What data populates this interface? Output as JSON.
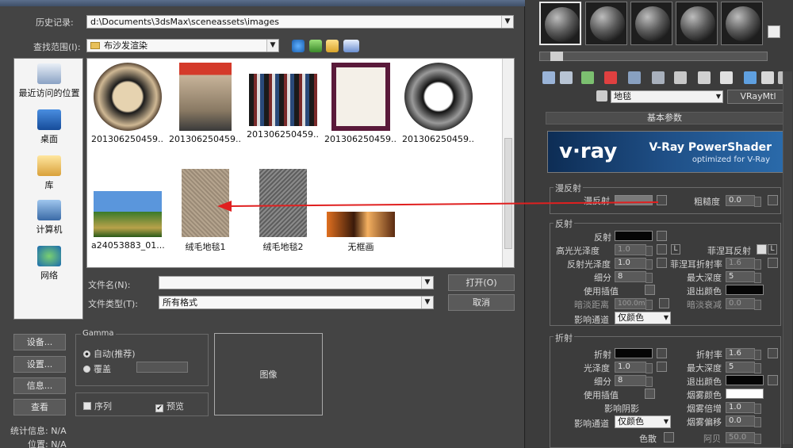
{
  "dialog": {
    "history_label": "历史记录:",
    "history_value": "d:\\Documents\\3dsMax\\sceneassets\\images",
    "lookin_label": "查找范围(I):",
    "lookin_value": "布沙发渲染",
    "places": [
      {
        "label": "最近访问的位置",
        "icon": "recent-places-icon"
      },
      {
        "label": "桌面",
        "icon": "desktop-icon"
      },
      {
        "label": "库",
        "icon": "libraries-icon"
      },
      {
        "label": "计算机",
        "icon": "computer-icon"
      },
      {
        "label": "网络",
        "icon": "network-icon"
      }
    ],
    "files": [
      {
        "name": "201306250459...",
        "kind": "round-rug-dark"
      },
      {
        "name": "201306250459...",
        "kind": "magazine"
      },
      {
        "name": "201306250459...",
        "kind": "books"
      },
      {
        "name": "201306250459...",
        "kind": "wine-label"
      },
      {
        "name": "201306250459...",
        "kind": "round-rug-grey"
      },
      {
        "name": "a24053883_01...",
        "kind": "landscape"
      },
      {
        "name": "绒毛地毯1",
        "kind": "carpet-beige"
      },
      {
        "name": "绒毛地毯2",
        "kind": "carpet-grey"
      },
      {
        "name": "无框画",
        "kind": "abstract"
      }
    ],
    "filename_label": "文件名(N):",
    "filename_value": "",
    "filetype_label": "文件类型(T):",
    "filetype_value": "所有格式",
    "open_button": "打开(O)",
    "cancel_button": "取消",
    "left_buttons": [
      "设备...",
      "设置...",
      "信息...",
      "查看"
    ],
    "gamma": {
      "title": "Gamma",
      "auto": "自动(推荐)",
      "override": "覆盖"
    },
    "sequence_label": "序列",
    "preview_label": "预览",
    "preview_checked": true,
    "image_label": "图像",
    "stats_label": "统计信息: N/A",
    "location_label": "位置: N/A"
  },
  "material": {
    "name": "地毯",
    "type_button": "VRayMtl",
    "rollout_title": "基本参数",
    "banner_title": "V-Ray PowerShader",
    "banner_sub": "optimized for V-Ray",
    "banner_logo": "v·ray",
    "diffuse": {
      "section": "漫反射",
      "diffuse_label": "漫反射",
      "roughness_label": "粗糙度",
      "roughness": "0.0"
    },
    "reflection": {
      "section": "反射",
      "reflect_label": "反射",
      "hilight_label": "高光光泽度",
      "hilight": "1.0",
      "lock": "L",
      "fresnel_label": "菲涅耳反射",
      "gloss_label": "反射光泽度",
      "gloss": "1.0",
      "fresnel_ior_label": "菲涅耳折射率",
      "fresnel_ior": "1.6",
      "subdivs_label": "细分",
      "subdivs": "8",
      "maxdepth_label": "最大深度",
      "maxdepth": "5",
      "interp_label": "使用插值",
      "exitcolor_label": "退出颜色",
      "dimdist_label": "暗淡距离",
      "dimdist": "100.0m",
      "dimfall_label": "暗淡衰减",
      "dimfall": "0.0",
      "affect_label": "影响通道",
      "affect_value": "仅颜色"
    },
    "refraction": {
      "section": "折射",
      "refract_label": "折射",
      "ior_label": "折射率",
      "ior": "1.6",
      "gloss_label": "光泽度",
      "gloss": "1.0",
      "maxdepth_label": "最大深度",
      "maxdepth": "5",
      "subdivs_label": "细分",
      "subdivs": "8",
      "exitcolor_label": "退出颜色",
      "interp_label": "使用插值",
      "fogcolor_label": "烟雾颜色",
      "shadows_label": "影响阴影",
      "fogmult_label": "烟雾倍增",
      "fogmult": "1.0",
      "affect_label": "影响通道",
      "affect_value": "仅颜色",
      "fogbias_label": "烟雾偏移",
      "fogbias": "0.0",
      "dispersion_label": "色散",
      "abbe_label": "阿贝",
      "abbe": "50.0"
    }
  },
  "colors": {
    "annotation_arrow": "#e02020",
    "vray_banner": "#1f4f86"
  }
}
